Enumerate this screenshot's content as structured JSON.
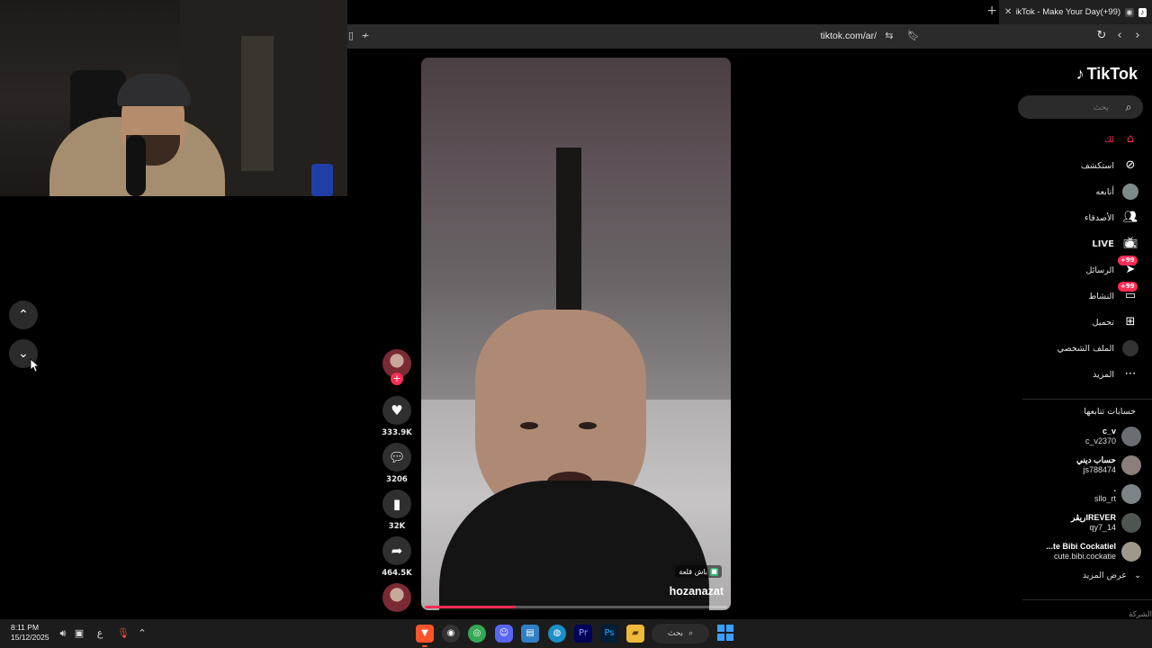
{
  "browser": {
    "tab_title": "(99+)TikTok - Make Your Day",
    "tab_favicon": "tiktok-icon",
    "url": "tiktok.com/ar/"
  },
  "video": {
    "author": "hozanazat",
    "tag_label": "باش قلعة",
    "progress_fraction": 0.3
  },
  "actions": {
    "likes": "333.9K",
    "comments": "3206",
    "saves": "32K",
    "shares": "464.5K"
  },
  "sidebar": {
    "logo_text": "TikTok",
    "search_placeholder": "بحث",
    "nav": [
      {
        "label": "لك",
        "icon": "home-icon",
        "active": true
      },
      {
        "label": "استكشف",
        "icon": "compass-icon"
      },
      {
        "label": "أتابعه",
        "icon": "following-avatar-icon"
      },
      {
        "label": "الأصدقاء",
        "icon": "friends-icon"
      },
      {
        "label": "LIVE",
        "icon": "live-icon"
      },
      {
        "label": "الرسائل",
        "icon": "messages-icon",
        "badge": "+99"
      },
      {
        "label": "النشاط",
        "icon": "activity-icon",
        "badge": "+99"
      },
      {
        "label": "تحميل",
        "icon": "upload-icon"
      },
      {
        "label": "الملف الشخصي",
        "icon": "profile-avatar-icon"
      },
      {
        "label": "المزيد",
        "icon": "more-icon"
      }
    ],
    "following_title": "حسابات تتابعها",
    "accounts": [
      {
        "username": "c_v",
        "name": "c_v2370"
      },
      {
        "username": "حساب ديني",
        "name": "js788474"
      },
      {
        "username": ".",
        "name": "sllo_rt"
      },
      {
        "username": "IREVERريڤر",
        "name": "qy7_14"
      },
      {
        "username": "te Bibi Cockatiel...",
        "name": "cute.bibi.cockatie"
      }
    ],
    "show_more": "عرض المزيد",
    "company": "الشركة"
  },
  "taskbar": {
    "time": "8:11 PM",
    "date": "15/12/2025",
    "lang": "ع",
    "search_label": "بحث"
  },
  "colors": {
    "accent": "#fe2c55",
    "page_bg": "#000000",
    "chrome_bg": "#2b2b2b"
  }
}
